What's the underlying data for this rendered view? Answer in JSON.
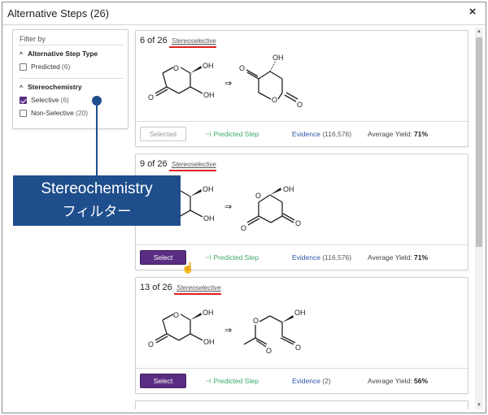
{
  "dialog": {
    "title": "Alternative Steps (26)",
    "close_glyph": "×"
  },
  "filter": {
    "heading": "Filter by",
    "sections": [
      {
        "title": "Alternative Step Type",
        "caret": "^",
        "options": [
          {
            "label": "Predicted",
            "count": "(6)",
            "checked": false
          }
        ]
      },
      {
        "title": "Stereochemistry",
        "caret": "^",
        "options": [
          {
            "label": "Selective",
            "count": "(6)",
            "checked": true
          },
          {
            "label": "Non-Selective",
            "count": "(20)",
            "checked": false
          }
        ]
      }
    ]
  },
  "cards": [
    {
      "count": "6 of 26",
      "tag": "Stereoselective",
      "reactant_labels": [
        "OH",
        "O",
        "O",
        "OH"
      ],
      "product_labels": [
        "OH",
        "O",
        "O",
        "O"
      ],
      "button": "Selected",
      "predicted": "Predicted Step",
      "evidence_label": "Evidence",
      "evidence_count": "(116,576)",
      "yield_label": "Average Yield:",
      "yield_value": "71%"
    },
    {
      "count": "9 of 26",
      "tag": "Stereoselective",
      "reactant_labels": [
        "OH",
        "O",
        "OH"
      ],
      "product_labels": [
        "OH",
        "O",
        "O",
        "O"
      ],
      "button": "Select",
      "predicted": "Predicted Step",
      "evidence_label": "Evidence",
      "evidence_count": "(116,576)",
      "yield_label": "Average Yield:",
      "yield_value": "71%"
    },
    {
      "count": "13 of 26",
      "tag": "Stereoselective",
      "reactant_labels": [
        "OH",
        "O",
        "O",
        "OH"
      ],
      "product_labels": [
        "OH",
        "O",
        "O",
        "O"
      ],
      "button": "Select",
      "predicted": "Predicted Step",
      "evidence_label": "Evidence",
      "evidence_count": "(2)",
      "yield_label": "Average Yield:",
      "yield_value": "56%"
    }
  ],
  "reaction_arrow": "⇒",
  "predicted_icon": "⊣",
  "callout": {
    "line1": "Stereochemistry",
    "line2": "フィルター"
  },
  "colors": {
    "accent": "#5a2d82",
    "predicted": "#3aa866",
    "link": "#2a55a8",
    "callout": "#1f4e8c",
    "underline": "#e02020"
  },
  "icons": {
    "close": "close-icon",
    "checkbox": "checkbox-icon",
    "arrow": "reaction-arrow-icon",
    "cursor": "hand-cursor-icon"
  }
}
